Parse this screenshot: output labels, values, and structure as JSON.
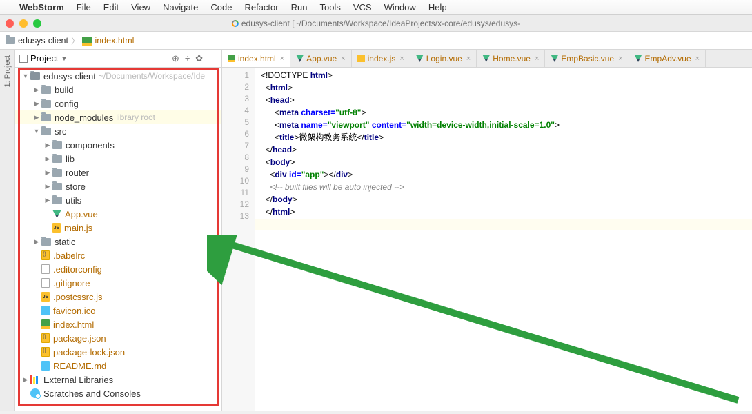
{
  "menubar": {
    "app": "WebStorm",
    "items": [
      "File",
      "Edit",
      "View",
      "Navigate",
      "Code",
      "Refactor",
      "Run",
      "Tools",
      "VCS",
      "Window",
      "Help"
    ]
  },
  "titlebar": {
    "title": "edusys-client [~/Documents/Workspace/IdeaProjects/x-core/edusys/edusys-"
  },
  "breadcrumb": {
    "root": "edusys-client",
    "file": "index.html"
  },
  "panel": {
    "title": "Project"
  },
  "left_gutter": {
    "label": "1: Project"
  },
  "tree": {
    "root": {
      "name": "edusys-client",
      "path": "~/Documents/Workspace/Ide"
    },
    "items": [
      {
        "name": "build",
        "type": "folder",
        "depth": 1,
        "arrow": "▶"
      },
      {
        "name": "config",
        "type": "folder",
        "depth": 1,
        "arrow": "▶"
      },
      {
        "name": "node_modules",
        "type": "folder",
        "depth": 1,
        "arrow": "▶",
        "suffix": "library root",
        "highlight": true
      },
      {
        "name": "src",
        "type": "folder",
        "depth": 1,
        "arrow": "▼"
      },
      {
        "name": "components",
        "type": "folder",
        "depth": 2,
        "arrow": "▶"
      },
      {
        "name": "lib",
        "type": "folder",
        "depth": 2,
        "arrow": "▶"
      },
      {
        "name": "router",
        "type": "folder",
        "depth": 2,
        "arrow": "▶"
      },
      {
        "name": "store",
        "type": "folder",
        "depth": 2,
        "arrow": "▶"
      },
      {
        "name": "utils",
        "type": "folder",
        "depth": 2,
        "arrow": "▶"
      },
      {
        "name": "App.vue",
        "type": "vue",
        "depth": 2,
        "orange": true
      },
      {
        "name": "main.js",
        "type": "js",
        "depth": 2,
        "orange": true
      },
      {
        "name": "static",
        "type": "folder",
        "depth": 1,
        "arrow": "▶"
      },
      {
        "name": ".babelrc",
        "type": "json",
        "depth": 1,
        "orange": true
      },
      {
        "name": ".editorconfig",
        "type": "file",
        "depth": 1,
        "orange": true
      },
      {
        "name": ".gitignore",
        "type": "file",
        "depth": 1,
        "orange": true
      },
      {
        "name": ".postcssrc.js",
        "type": "js",
        "depth": 1,
        "orange": true
      },
      {
        "name": "favicon.ico",
        "type": "ico",
        "depth": 1,
        "orange": true
      },
      {
        "name": "index.html",
        "type": "html",
        "depth": 1,
        "orange": true
      },
      {
        "name": "package.json",
        "type": "json",
        "depth": 1,
        "orange": true
      },
      {
        "name": "package-lock.json",
        "type": "json",
        "depth": 1,
        "orange": true
      },
      {
        "name": "README.md",
        "type": "md",
        "depth": 1,
        "orange": true
      }
    ],
    "ext_libs": "External Libraries",
    "scratches": "Scratches and Consoles"
  },
  "tabs": [
    {
      "label": "index.html",
      "icon": "html",
      "active": true
    },
    {
      "label": "App.vue",
      "icon": "vue"
    },
    {
      "label": "index.js",
      "icon": "js"
    },
    {
      "label": "Login.vue",
      "icon": "vue"
    },
    {
      "label": "Home.vue",
      "icon": "vue"
    },
    {
      "label": "EmpBasic.vue",
      "icon": "vue"
    },
    {
      "label": "EmpAdv.vue",
      "icon": "vue"
    }
  ],
  "code": {
    "lines": [
      {
        "n": 1,
        "html": "&lt;!DOCTYPE <span class='kw'>html</span>&gt;"
      },
      {
        "n": 2,
        "html": "&lt;<span class='tag'>html</span>&gt;"
      },
      {
        "n": 3,
        "html": "&lt;<span class='tag'>head</span>&gt;"
      },
      {
        "n": 4,
        "html": "  &lt;<span class='tag'>meta </span><span class='attr'>charset=</span><span class='str'>\"utf-8\"</span>&gt;"
      },
      {
        "n": 5,
        "html": "  &lt;<span class='tag'>meta </span><span class='attr'>name=</span><span class='str'>\"viewport\"</span> <span class='attr'>content=</span><span class='str'>\"width=device-width,initial-scale=1.0\"</span>&gt;"
      },
      {
        "n": 6,
        "html": "  &lt;<span class='tag'>title</span>&gt;微架构教务系统&lt;/<span class='tag'>title</span>&gt;"
      },
      {
        "n": 7,
        "html": "&lt;/<span class='tag'>head</span>&gt;"
      },
      {
        "n": 8,
        "html": "&lt;<span class='tag'>body</span>&gt;"
      },
      {
        "n": 9,
        "html": "&lt;<span class='tag'>div </span><span class='attr'>id=</span><span class='str'>\"app\"</span>&gt;&lt;/<span class='tag'>div</span>&gt;"
      },
      {
        "n": 10,
        "html": "<span class='cmt'>&lt;!-- built files will be auto injected --&gt;</span>"
      },
      {
        "n": 11,
        "html": "&lt;/<span class='tag'>body</span>&gt;"
      },
      {
        "n": 12,
        "html": "&lt;/<span class='tag'>html</span>&gt;"
      },
      {
        "n": 13,
        "html": "",
        "hl": true
      }
    ]
  }
}
